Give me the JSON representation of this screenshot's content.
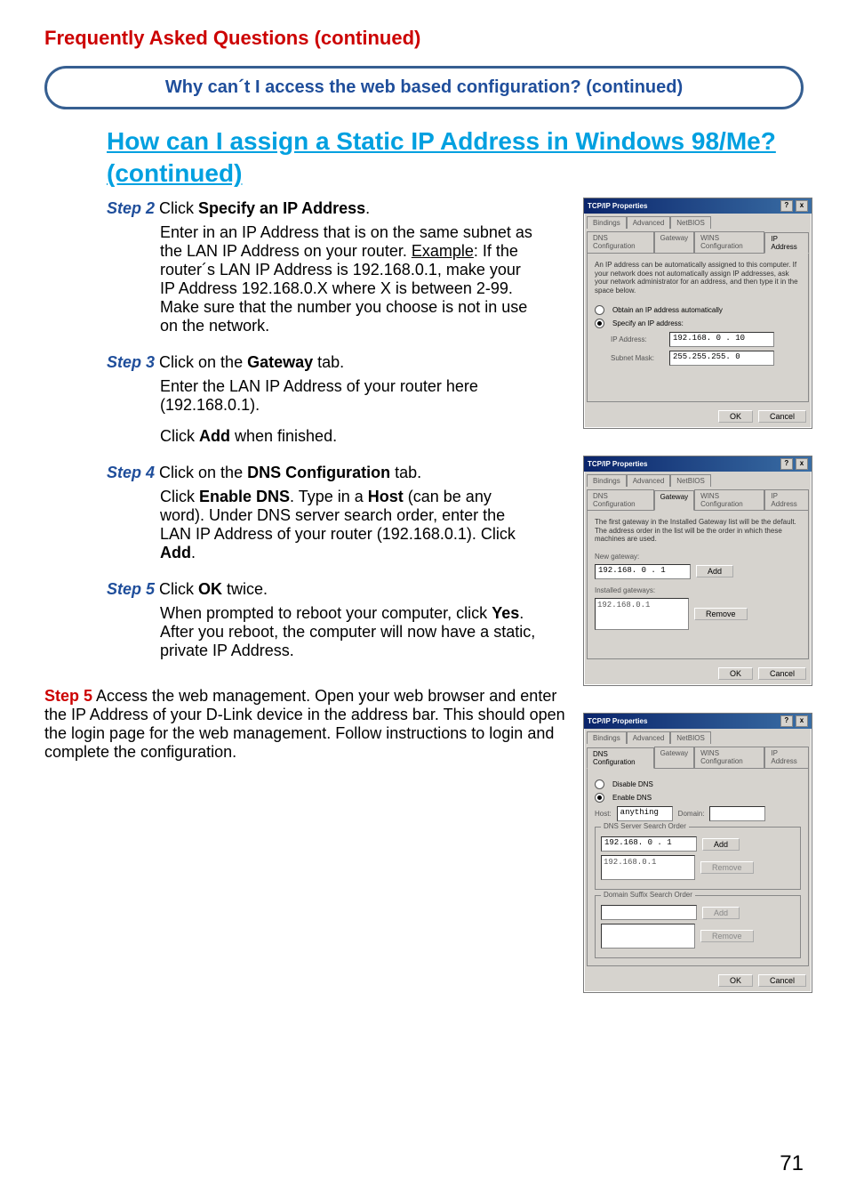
{
  "page": {
    "title": "Frequently Asked Questions (continued)",
    "banner": "Why can´t I access the web based configuration? (continued)",
    "main_heading": "How can I assign a Static IP Address in Windows 98/Me?  (continued)",
    "page_number": "71"
  },
  "steps": {
    "s2": {
      "label": "Step 2",
      "lead": " Click ",
      "bold1": "Specify an IP Address",
      "tail1": ".",
      "para_a": "Enter in an IP Address that is on the same subnet as the LAN IP Address on your router. ",
      "example_label": "Example",
      "para_b": ": If the router´s LAN IP Address is 192.168.0.1, make your IP Address 192.168.0.X where X is between 2-99. Make sure that the number you choose is not in use on the network."
    },
    "s3": {
      "label": "Step 3",
      "lead": " Click on the ",
      "bold1": "Gateway",
      "tail1": " tab.",
      "para_a": "Enter the LAN IP Address of your router here (192.168.0.1).",
      "para_b_a": "Click ",
      "para_b_bold": "Add",
      "para_b_c": " when finished."
    },
    "s4": {
      "label": "Step 4",
      "lead": " Click on the ",
      "bold1": "DNS Configuration",
      "tail1": " tab.",
      "p1": "Click ",
      "p1b": "Enable DNS",
      "p2": ". Type in a ",
      "p2b": "Host",
      "p3": " (can be any word). Under DNS server search order, enter the LAN IP Address of your router (192.168.0.1). Click ",
      "p3b": "Add",
      "p4": "."
    },
    "s5a": {
      "label": "Step 5",
      "lead": " Click ",
      "bold1": "OK",
      "tail1": " twice.",
      "p1": "When prompted to reboot your computer, click ",
      "p1b": "Yes",
      "p1c": ".",
      "p2": "After you reboot, the computer will now have a static, private IP Address."
    },
    "s5b": {
      "label": "Step 5",
      "text": " Access the web management. Open your web browser and enter the IP Address of your D-Link device in the address bar. This should open the login page for the web management. Follow instructions to login and complete the configuration."
    }
  },
  "dialogs": {
    "common": {
      "title": "TCP/IP Properties",
      "help": "?",
      "close": "x",
      "ok": "OK",
      "cancel": "Cancel",
      "tabs": {
        "bindings": "Bindings",
        "advanced": "Advanced",
        "netbios": "NetBIOS",
        "dnsconf": "DNS Configuration",
        "gateway": "Gateway",
        "winsconf": "WINS Configuration",
        "ipaddr": "IP Address"
      }
    },
    "d1": {
      "desc": "An IP address can be automatically assigned to this computer. If your network does not automatically assign IP addresses, ask your network administrator for an address, and then type it in the space below.",
      "opt_auto": "Obtain an IP address automatically",
      "opt_spec": "Specify an IP address:",
      "ip_label": "IP Address:",
      "ip_value": "192.168. 0 . 10",
      "mask_label": "Subnet Mask:",
      "mask_value": "255.255.255. 0"
    },
    "d2": {
      "desc": "The first gateway in the Installed Gateway list will be the default. The address order in the list will be the order in which these machines are used.",
      "new_gw": "New gateway:",
      "new_gw_val": "192.168. 0 . 1",
      "add": "Add",
      "installed": "Installed gateways:",
      "installed_val": "192.168.0.1",
      "remove": "Remove"
    },
    "d3": {
      "disable": "Disable DNS",
      "enable": "Enable DNS",
      "host_l": "Host:",
      "host_v": "anything",
      "domain_l": "Domain:",
      "search_order": "DNS Server Search Order",
      "input_val": "192.168. 0 . 1",
      "list_val": "192.168.0.1",
      "add": "Add",
      "remove": "Remove",
      "suffix": "Domain Suffix Search Order",
      "add2": "Add",
      "remove2": "Remove"
    }
  }
}
